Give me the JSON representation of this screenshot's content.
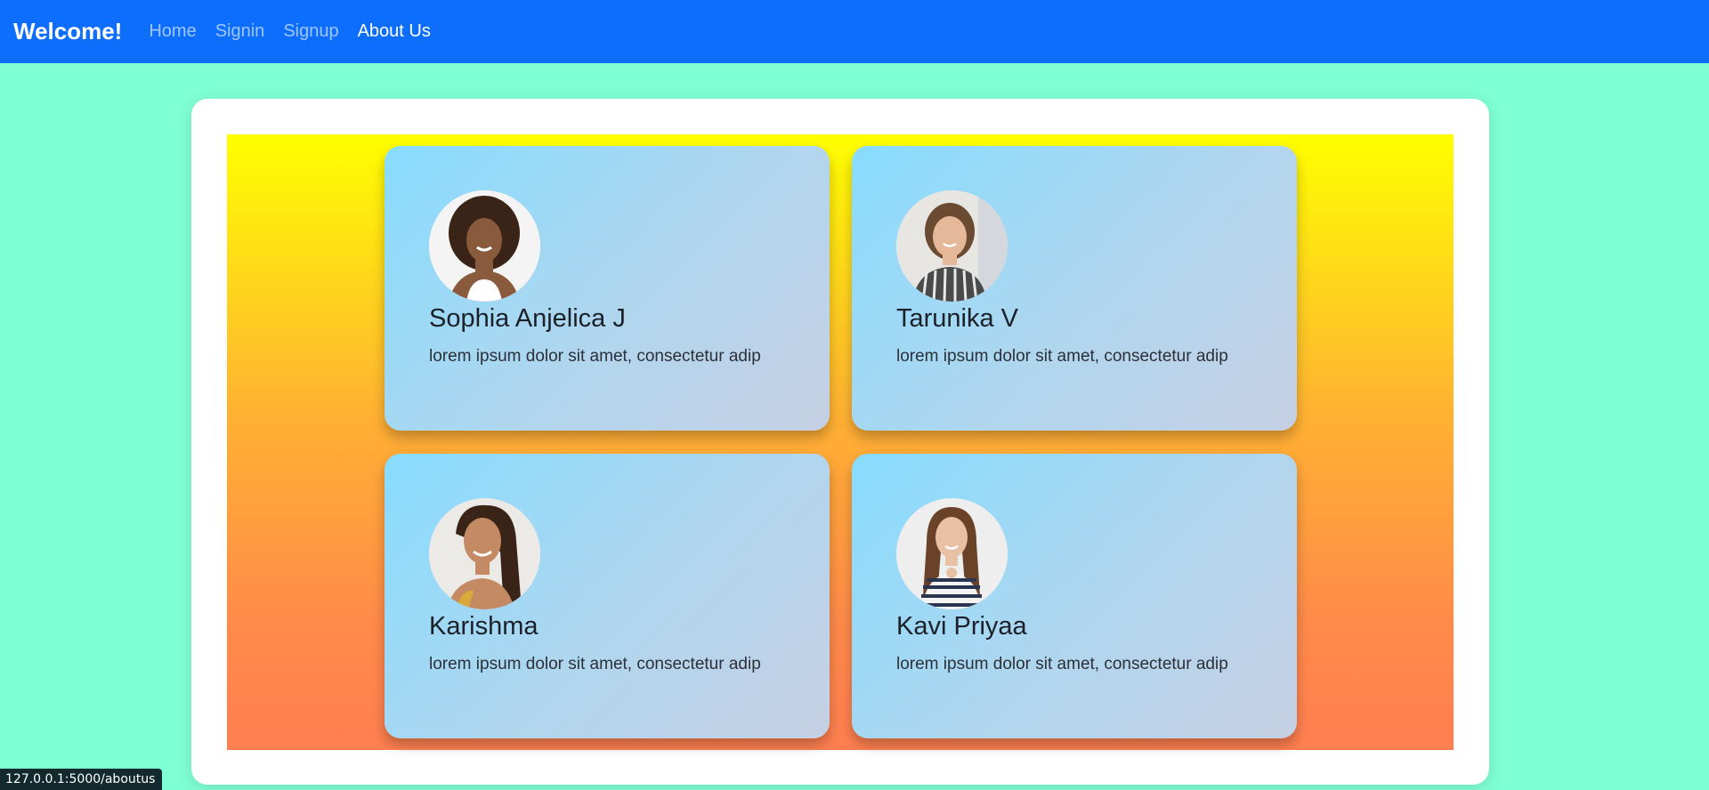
{
  "navbar": {
    "brand": "Welcome!",
    "links": [
      {
        "label": "Home"
      },
      {
        "label": "Signin"
      },
      {
        "label": "Signup"
      },
      {
        "label": "About Us",
        "active": true
      }
    ]
  },
  "team": [
    {
      "name": "Sophia Anjelica J",
      "description": "lorem ipsum dolor sit amet, consectetur adip"
    },
    {
      "name": "Tarunika V",
      "description": "lorem ipsum dolor sit amet, consectetur adip"
    },
    {
      "name": "Karishma",
      "description": "lorem ipsum dolor sit amet, consectetur adip"
    },
    {
      "name": "Kavi Priyaa",
      "description": "lorem ipsum dolor sit amet, consectetur adip"
    }
  ],
  "statusbar": {
    "url": "127.0.0.1:5000/aboutus"
  },
  "colors": {
    "navbar": "#0d6efd",
    "page_background": "#7fffd4",
    "gradient_top": "#ffff00",
    "gradient_bottom": "#ff7f50"
  }
}
